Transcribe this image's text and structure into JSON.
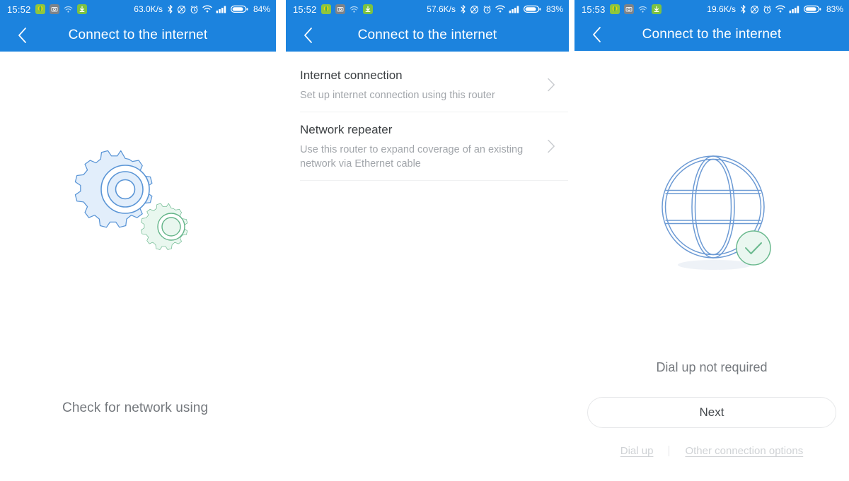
{
  "theme": {
    "brand_blue": "#1c83de",
    "gear_blue": "#4a90d9",
    "gear_green": "#65b68a",
    "globe_blue": "#4a7fc1",
    "badge_green": "#6ab98e",
    "text_gray": "#75797e",
    "muted_gray": "#a2a6ab",
    "link_gray": "#cfd2d5"
  },
  "panels": [
    {
      "id": "panel-1",
      "status_bar": {
        "clock": "15:52",
        "network_speed": "63.0K/s",
        "battery_percent": "84%",
        "left_icons": [
          "app-icon",
          "screenshot-icon",
          "wifi-small-icon",
          "download-icon"
        ],
        "right_icons": [
          "bluetooth-icon",
          "silent-mode-icon",
          "alarm-icon",
          "wifi-icon",
          "signal-icon",
          "battery-icon"
        ]
      },
      "header": {
        "title": "Connect to the internet",
        "back_icon": "chevron-left-icon"
      },
      "illustration": "gears-illustration",
      "footer_text": "Check for network using"
    },
    {
      "id": "panel-2",
      "status_bar": {
        "clock": "15:52",
        "network_speed": "57.6K/s",
        "battery_percent": "83%",
        "left_icons": [
          "app-icon",
          "screenshot-icon",
          "wifi-small-icon",
          "download-icon"
        ],
        "right_icons": [
          "bluetooth-icon",
          "silent-mode-icon",
          "alarm-icon",
          "wifi-icon",
          "signal-icon",
          "battery-icon"
        ]
      },
      "header": {
        "title": "Connect to the internet",
        "back_icon": "chevron-left-icon"
      },
      "list": [
        {
          "title": "Internet connection",
          "subtitle": "Set up internet connection using this router",
          "chevron": "chevron-right-icon"
        },
        {
          "title": "Network repeater",
          "subtitle": "Use this router to expand coverage of an existing network via Ethernet cable",
          "chevron": "chevron-right-icon"
        }
      ]
    },
    {
      "id": "panel-3",
      "status_bar": {
        "clock": "15:53",
        "network_speed": "19.6K/s",
        "battery_percent": "83%",
        "left_icons": [
          "app-icon",
          "screenshot-icon",
          "wifi-small-icon",
          "download-icon"
        ],
        "right_icons": [
          "bluetooth-icon",
          "silent-mode-icon",
          "alarm-icon",
          "wifi-icon",
          "signal-icon",
          "battery-icon"
        ]
      },
      "header": {
        "title": "Connect to the internet",
        "back_icon": "chevron-left-icon"
      },
      "illustration": "globe-with-check-badge",
      "status_text": "Dial up not required",
      "primary_button": "Next",
      "links": [
        {
          "label": "Dial up"
        },
        {
          "label": "Other connection options"
        }
      ]
    }
  ]
}
